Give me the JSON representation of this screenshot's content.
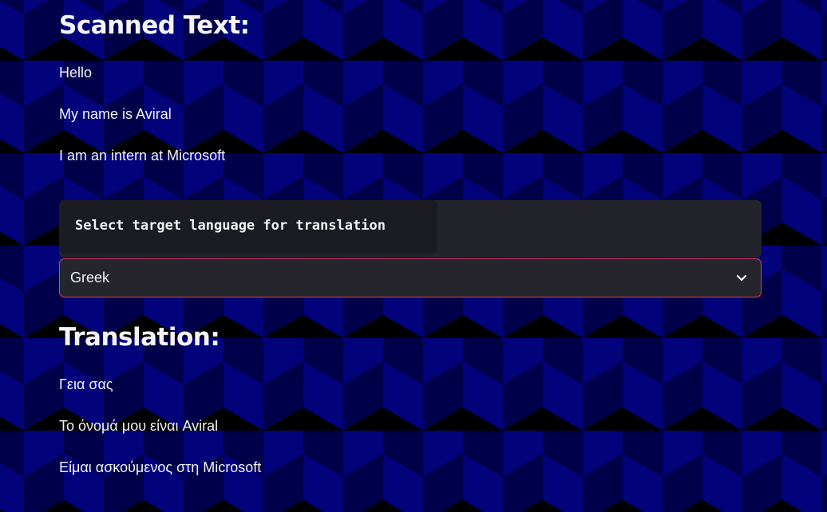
{
  "scanned": {
    "heading": "Scanned Text:",
    "lines": [
      "Hello",
      "My name is Aviral",
      "I am an intern at Microsoft"
    ]
  },
  "language_select": {
    "label": "Select target language for translation",
    "selected": "Greek",
    "icon": "chevron-down-icon",
    "border_color": "#e0424c"
  },
  "translation": {
    "heading": "Translation:",
    "lines": [
      "Γεια σας",
      "Το όνομά μου είναι Aviral",
      "Είμαι ασκούμενος στη Microsoft"
    ]
  },
  "theme": {
    "background_pattern": "isometric-cubes",
    "colors": [
      "#02027a",
      "#00004a",
      "#000000"
    ]
  }
}
